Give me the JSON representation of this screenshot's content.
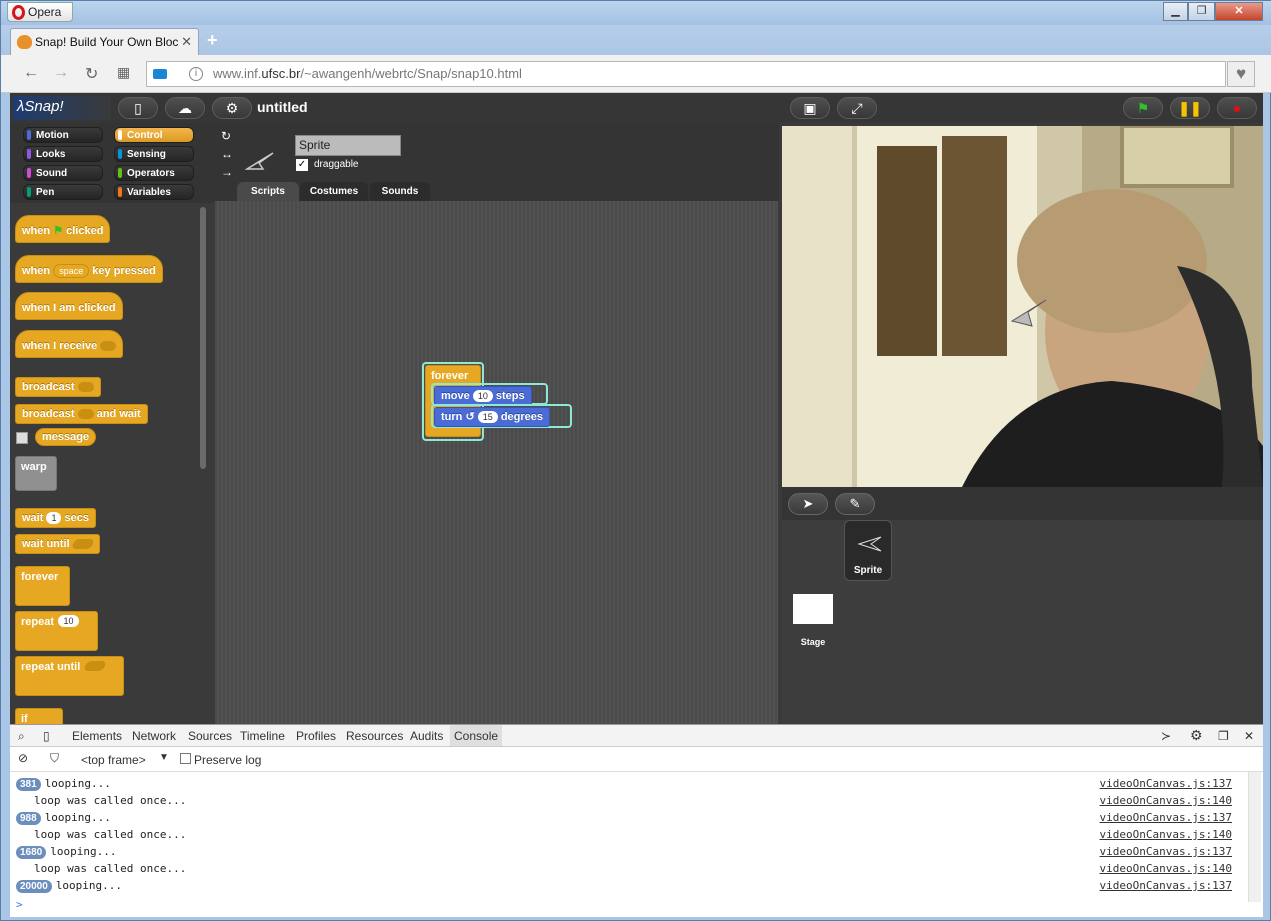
{
  "browser": {
    "menu_label": "Opera",
    "tab_title": "Snap! Build Your Own Bloc",
    "url_host_prefix": "www.inf.",
    "url_host_domain": "ufsc.br",
    "url_path": "/~awangenh/webrtc/Snap/snap10.html"
  },
  "snap": {
    "logo": "λSnap!",
    "project_title": "untitled",
    "categories": [
      "Motion",
      "Control",
      "Looks",
      "Sensing",
      "Sound",
      "Operators",
      "Pen",
      "Variables"
    ],
    "category_colors": {
      "Motion": "#4a6cd4",
      "Looks": "#8f56e3",
      "Sound": "#cf4ad9",
      "Pen": "#00a178",
      "Control": "#e6a822",
      "Sensing": "#0494dc",
      "Operators": "#62c213",
      "Variables": "#f3761d"
    },
    "palette": {
      "when_label": "when",
      "clicked": "clicked",
      "key_pressed": "key pressed",
      "space": "space",
      "when_i_am_clicked": "when I am clicked",
      "when_i_receive": "when I receive",
      "broadcast": "broadcast",
      "and_wait": "and wait",
      "message": "message",
      "warp": "warp",
      "wait": "wait",
      "wait_value": "1",
      "secs": "secs",
      "wait_until": "wait until",
      "forever": "forever",
      "repeat": "repeat",
      "repeat_value": "10",
      "repeat_until": "repeat until",
      "if": "if"
    },
    "sprite": {
      "name": "Sprite",
      "draggable_label": "draggable",
      "draggable_checked": "✓"
    },
    "editor_tabs": [
      "Scripts",
      "Costumes",
      "Sounds"
    ],
    "script": {
      "forever": "forever",
      "move": "move",
      "move_value": "10",
      "steps": "steps",
      "turn": "turn",
      "turn_value": "15",
      "degrees": "degrees"
    },
    "corral": {
      "sprite_label": "Sprite",
      "stage_label": "Stage"
    }
  },
  "devtools": {
    "tabs": [
      "Elements",
      "Network",
      "Sources",
      "Timeline",
      "Profiles",
      "Resources",
      "Audits",
      "Console"
    ],
    "frame": "<top frame>",
    "preserve_log": "Preserve log",
    "console": [
      {
        "count": "381",
        "text": "looping...",
        "src": "videoOnCanvas.js:137"
      },
      {
        "count": "",
        "text": "loop was called once...",
        "src": "videoOnCanvas.js:140"
      },
      {
        "count": "988",
        "text": "looping...",
        "src": "videoOnCanvas.js:137"
      },
      {
        "count": "",
        "text": "loop was called once...",
        "src": "videoOnCanvas.js:140"
      },
      {
        "count": "1680",
        "text": "looping...",
        "src": "videoOnCanvas.js:137"
      },
      {
        "count": "",
        "text": "loop was called once...",
        "src": "videoOnCanvas.js:140"
      },
      {
        "count": "20000",
        "text": "looping...",
        "src": "videoOnCanvas.js:137"
      }
    ],
    "prompt": ">"
  }
}
